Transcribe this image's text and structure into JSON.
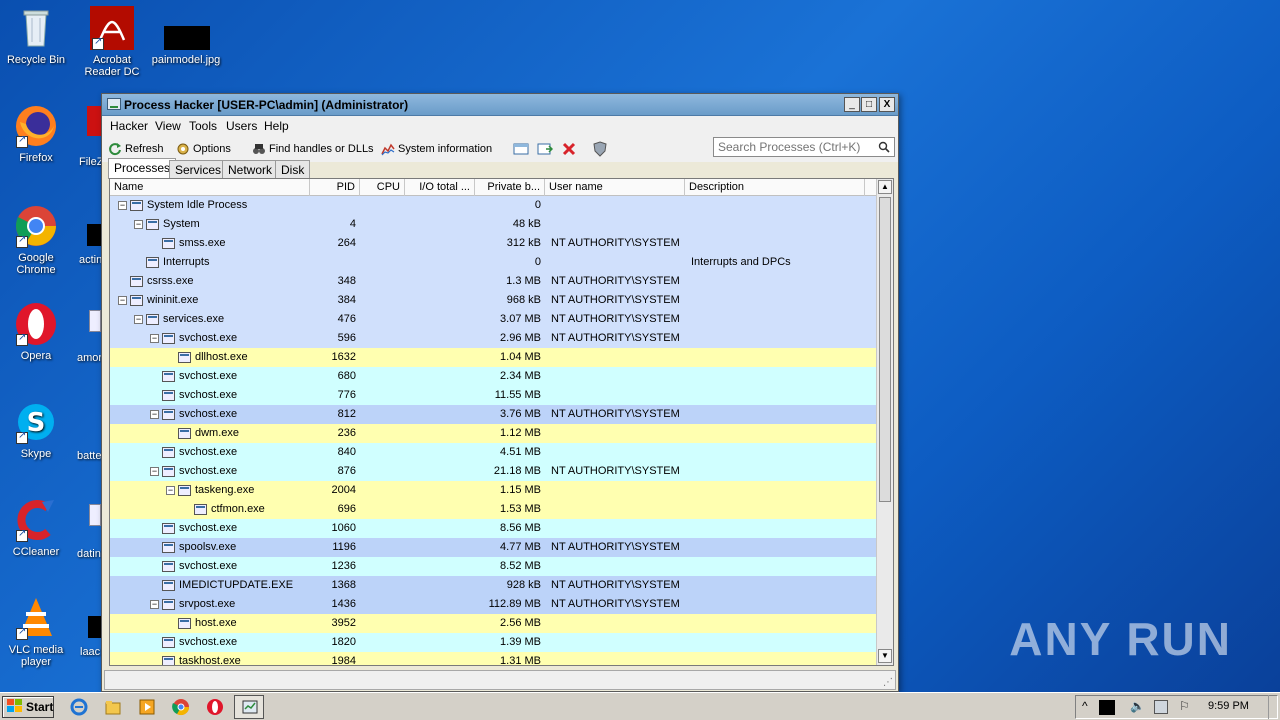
{
  "desktop": {
    "icons": [
      {
        "label": "Recycle Bin",
        "icon": "recycle-bin-icon"
      },
      {
        "label": "Acrobat Reader DC",
        "icon": "acrobat-icon"
      },
      {
        "label": "painmodel.jpg",
        "icon": "image-file-icon"
      },
      {
        "label": "Firefox",
        "icon": "firefox-icon"
      },
      {
        "label": "FileZ",
        "icon": "filezilla-icon"
      },
      {
        "label": "Google Chrome",
        "icon": "chrome-icon"
      },
      {
        "label": "actin",
        "icon": "file-icon"
      },
      {
        "label": "Opera",
        "icon": "opera-icon"
      },
      {
        "label": "amor",
        "icon": "document-icon"
      },
      {
        "label": "Skype",
        "icon": "skype-icon"
      },
      {
        "label": "batte",
        "icon": "file-icon"
      },
      {
        "label": "CCleaner",
        "icon": "ccleaner-icon"
      },
      {
        "label": "datin",
        "icon": "document-icon"
      },
      {
        "label": "VLC media player",
        "icon": "vlc-icon"
      },
      {
        "label": "laac",
        "icon": "file-icon"
      }
    ],
    "watermark": "ANY RUN"
  },
  "window": {
    "title": "Process Hacker [USER-PC\\admin] (Administrator)",
    "controls": [
      "_",
      "□",
      "X"
    ],
    "menu": [
      "Hacker",
      "View",
      "Tools",
      "Users",
      "Help"
    ],
    "toolbar": {
      "refresh": "Refresh",
      "options": "Options",
      "find_handles": "Find handles or DLLs",
      "system_info": "System information"
    },
    "search_placeholder": "Search Processes (Ctrl+K)",
    "tabs": [
      "Processes",
      "Services",
      "Network",
      "Disk"
    ],
    "active_tab": "Processes",
    "columns": [
      "Name",
      "PID",
      "CPU",
      "I/O total ...",
      "Private b...",
      "User name",
      "Description"
    ],
    "processes": [
      {
        "name": "System Idle Process",
        "pid": "",
        "private": "0",
        "user": "",
        "desc": "",
        "depth": 0,
        "toggle": "−",
        "type": "svc"
      },
      {
        "name": "System",
        "pid": "4",
        "private": "48 kB",
        "user": "",
        "desc": "",
        "depth": 1,
        "toggle": "−",
        "type": "svc"
      },
      {
        "name": "smss.exe",
        "pid": "264",
        "private": "312 kB",
        "user": "NT AUTHORITY\\SYSTEM",
        "desc": "",
        "depth": 2,
        "toggle": "",
        "type": "svc"
      },
      {
        "name": "Interrupts",
        "pid": "",
        "private": "0",
        "user": "",
        "desc": "Interrupts and DPCs",
        "depth": 1,
        "toggle": "",
        "type": "svc"
      },
      {
        "name": "csrss.exe",
        "pid": "348",
        "private": "1.3 MB",
        "user": "NT AUTHORITY\\SYSTEM",
        "desc": "",
        "depth": 0,
        "toggle": "",
        "type": "svc"
      },
      {
        "name": "wininit.exe",
        "pid": "384",
        "private": "968 kB",
        "user": "NT AUTHORITY\\SYSTEM",
        "desc": "",
        "depth": 0,
        "toggle": "−",
        "type": "svc"
      },
      {
        "name": "services.exe",
        "pid": "476",
        "private": "3.07 MB",
        "user": "NT AUTHORITY\\SYSTEM",
        "desc": "",
        "depth": 1,
        "toggle": "−",
        "type": "svc"
      },
      {
        "name": "svchost.exe",
        "pid": "596",
        "private": "2.96 MB",
        "user": "NT AUTHORITY\\SYSTEM",
        "desc": "",
        "depth": 2,
        "toggle": "−",
        "type": "svc"
      },
      {
        "name": "dllhost.exe",
        "pid": "1632",
        "private": "1.04 MB",
        "user": "",
        "desc": "",
        "depth": 3,
        "toggle": "",
        "type": "own"
      },
      {
        "name": "svchost.exe",
        "pid": "680",
        "private": "2.34 MB",
        "user": "",
        "desc": "",
        "depth": 2,
        "toggle": "",
        "type": "usr"
      },
      {
        "name": "svchost.exe",
        "pid": "776",
        "private": "11.55 MB",
        "user": "",
        "desc": "",
        "depth": 2,
        "toggle": "",
        "type": "usr"
      },
      {
        "name": "svchost.exe",
        "pid": "812",
        "private": "3.76 MB",
        "user": "NT AUTHORITY\\SYSTEM",
        "desc": "",
        "depth": 2,
        "toggle": "−",
        "type": "svc2"
      },
      {
        "name": "dwm.exe",
        "pid": "236",
        "private": "1.12 MB",
        "user": "",
        "desc": "",
        "depth": 3,
        "toggle": "",
        "type": "own"
      },
      {
        "name": "svchost.exe",
        "pid": "840",
        "private": "4.51 MB",
        "user": "",
        "desc": "",
        "depth": 2,
        "toggle": "",
        "type": "usr"
      },
      {
        "name": "svchost.exe",
        "pid": "876",
        "private": "21.18 MB",
        "user": "NT AUTHORITY\\SYSTEM",
        "desc": "",
        "depth": 2,
        "toggle": "−",
        "type": "usr"
      },
      {
        "name": "taskeng.exe",
        "pid": "2004",
        "private": "1.15 MB",
        "user": "",
        "desc": "",
        "depth": 3,
        "toggle": "−",
        "type": "own"
      },
      {
        "name": "ctfmon.exe",
        "pid": "696",
        "private": "1.53 MB",
        "user": "",
        "desc": "",
        "depth": 4,
        "toggle": "",
        "type": "own"
      },
      {
        "name": "svchost.exe",
        "pid": "1060",
        "private": "8.56 MB",
        "user": "",
        "desc": "",
        "depth": 2,
        "toggle": "",
        "type": "usr"
      },
      {
        "name": "spoolsv.exe",
        "pid": "1196",
        "private": "4.77 MB",
        "user": "NT AUTHORITY\\SYSTEM",
        "desc": "",
        "depth": 2,
        "toggle": "",
        "type": "svc2"
      },
      {
        "name": "svchost.exe",
        "pid": "1236",
        "private": "8.52 MB",
        "user": "",
        "desc": "",
        "depth": 2,
        "toggle": "",
        "type": "usr"
      },
      {
        "name": "IMEDICTUPDATE.EXE",
        "pid": "1368",
        "private": "928 kB",
        "user": "NT AUTHORITY\\SYSTEM",
        "desc": "",
        "depth": 2,
        "toggle": "",
        "type": "svc2"
      },
      {
        "name": "srvpost.exe",
        "pid": "1436",
        "private": "112.89 MB",
        "user": "NT AUTHORITY\\SYSTEM",
        "desc": "",
        "depth": 2,
        "toggle": "−",
        "type": "svc2"
      },
      {
        "name": "host.exe",
        "pid": "3952",
        "private": "2.56 MB",
        "user": "",
        "desc": "",
        "depth": 3,
        "toggle": "",
        "type": "own"
      },
      {
        "name": "svchost.exe",
        "pid": "1820",
        "private": "1.39 MB",
        "user": "",
        "desc": "",
        "depth": 2,
        "toggle": "",
        "type": "usr"
      },
      {
        "name": "taskhost.exe",
        "pid": "1984",
        "private": "1.31 MB",
        "user": "",
        "desc": "",
        "depth": 2,
        "toggle": "",
        "type": "own"
      }
    ]
  },
  "taskbar": {
    "start_label": "Start",
    "clock": "9:59 PM",
    "tray_up_arrow": "^",
    "pinned": [
      "ie-icon",
      "explorer-icon",
      "media-player-icon",
      "chrome-icon",
      "opera-icon",
      "process-hacker-icon"
    ]
  }
}
